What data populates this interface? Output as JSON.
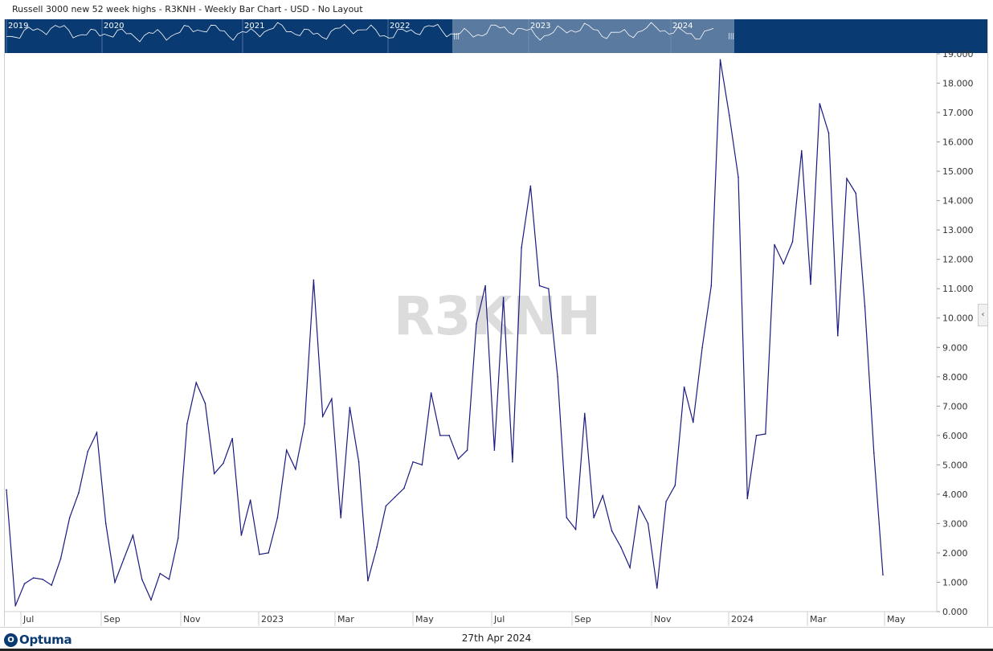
{
  "header": {
    "title": "Russell 3000 new 52 week highs - R3KNH - Weekly Bar Chart - USD - No Layout"
  },
  "navigator": {
    "years": [
      "2019",
      "2020",
      "2021",
      "2022",
      "2023",
      "2024"
    ],
    "handle_glyph": "|||"
  },
  "watermark": "R3KNH",
  "side_handle": {
    "icon": "chevron-left-icon",
    "glyph": "‹"
  },
  "footer": {
    "brand": "Optuma",
    "date": "27th Apr 2024"
  },
  "colors": {
    "line": "#1a1a80",
    "navigator_bg": "#0a3a72",
    "navigator_window": "#5a7aa0",
    "watermark": "#dcdcdc"
  },
  "chart_data": {
    "type": "line",
    "title": "Russell 3000 new 52 week highs - R3KNH - Weekly Bar Chart - USD - No Layout",
    "xlabel": "",
    "ylabel": "",
    "ylim": [
      0,
      19
    ],
    "grid": false,
    "y_ticks": [
      "0.000",
      "1.000",
      "2.000",
      "3.000",
      "4.000",
      "5.000",
      "6.000",
      "7.000",
      "8.000",
      "9.000",
      "10.000",
      "11.000",
      "12.000",
      "13.000",
      "14.000",
      "15.000",
      "16.000",
      "17.000",
      "18.000",
      "19.000"
    ],
    "x_tick_labels": [
      "Jul",
      "Sep",
      "Nov",
      "2023",
      "Mar",
      "May",
      "Jul",
      "Sep",
      "Nov",
      "2024",
      "Mar",
      "May"
    ],
    "series": [
      {
        "values": [
          4.15,
          0.2,
          0.95,
          1.15,
          1.1,
          0.9,
          1.8,
          3.2,
          4.05,
          5.45,
          6.1,
          3.0,
          1.0,
          1.8,
          2.6,
          1.1,
          0.4,
          1.3,
          1.1,
          2.5,
          6.4,
          7.8,
          7.1,
          4.7,
          5.05,
          5.9,
          2.6,
          3.8,
          1.95,
          2.0,
          3.2,
          5.5,
          4.85,
          6.4,
          11.3,
          6.65,
          7.25,
          3.2,
          6.95,
          5.1,
          1.05,
          2.2,
          3.6,
          3.9,
          4.2,
          5.1,
          5.0,
          7.45,
          6.0,
          6.0,
          5.2,
          5.5,
          9.8,
          11.1,
          5.5,
          10.7,
          5.1,
          12.4,
          14.5,
          11.1,
          11.0,
          8.0,
          3.2,
          2.8,
          6.75,
          3.2,
          3.95,
          2.75,
          2.2,
          1.5,
          3.6,
          3.0,
          0.8,
          3.75,
          4.3,
          7.65,
          6.45,
          9.0,
          11.1,
          18.8,
          16.9,
          14.8,
          3.85,
          6.0,
          6.05,
          12.5,
          11.85,
          12.6,
          15.7,
          11.15,
          17.3,
          16.3,
          9.4,
          14.75,
          14.25,
          10.4,
          5.4,
          1.25
        ]
      }
    ]
  }
}
